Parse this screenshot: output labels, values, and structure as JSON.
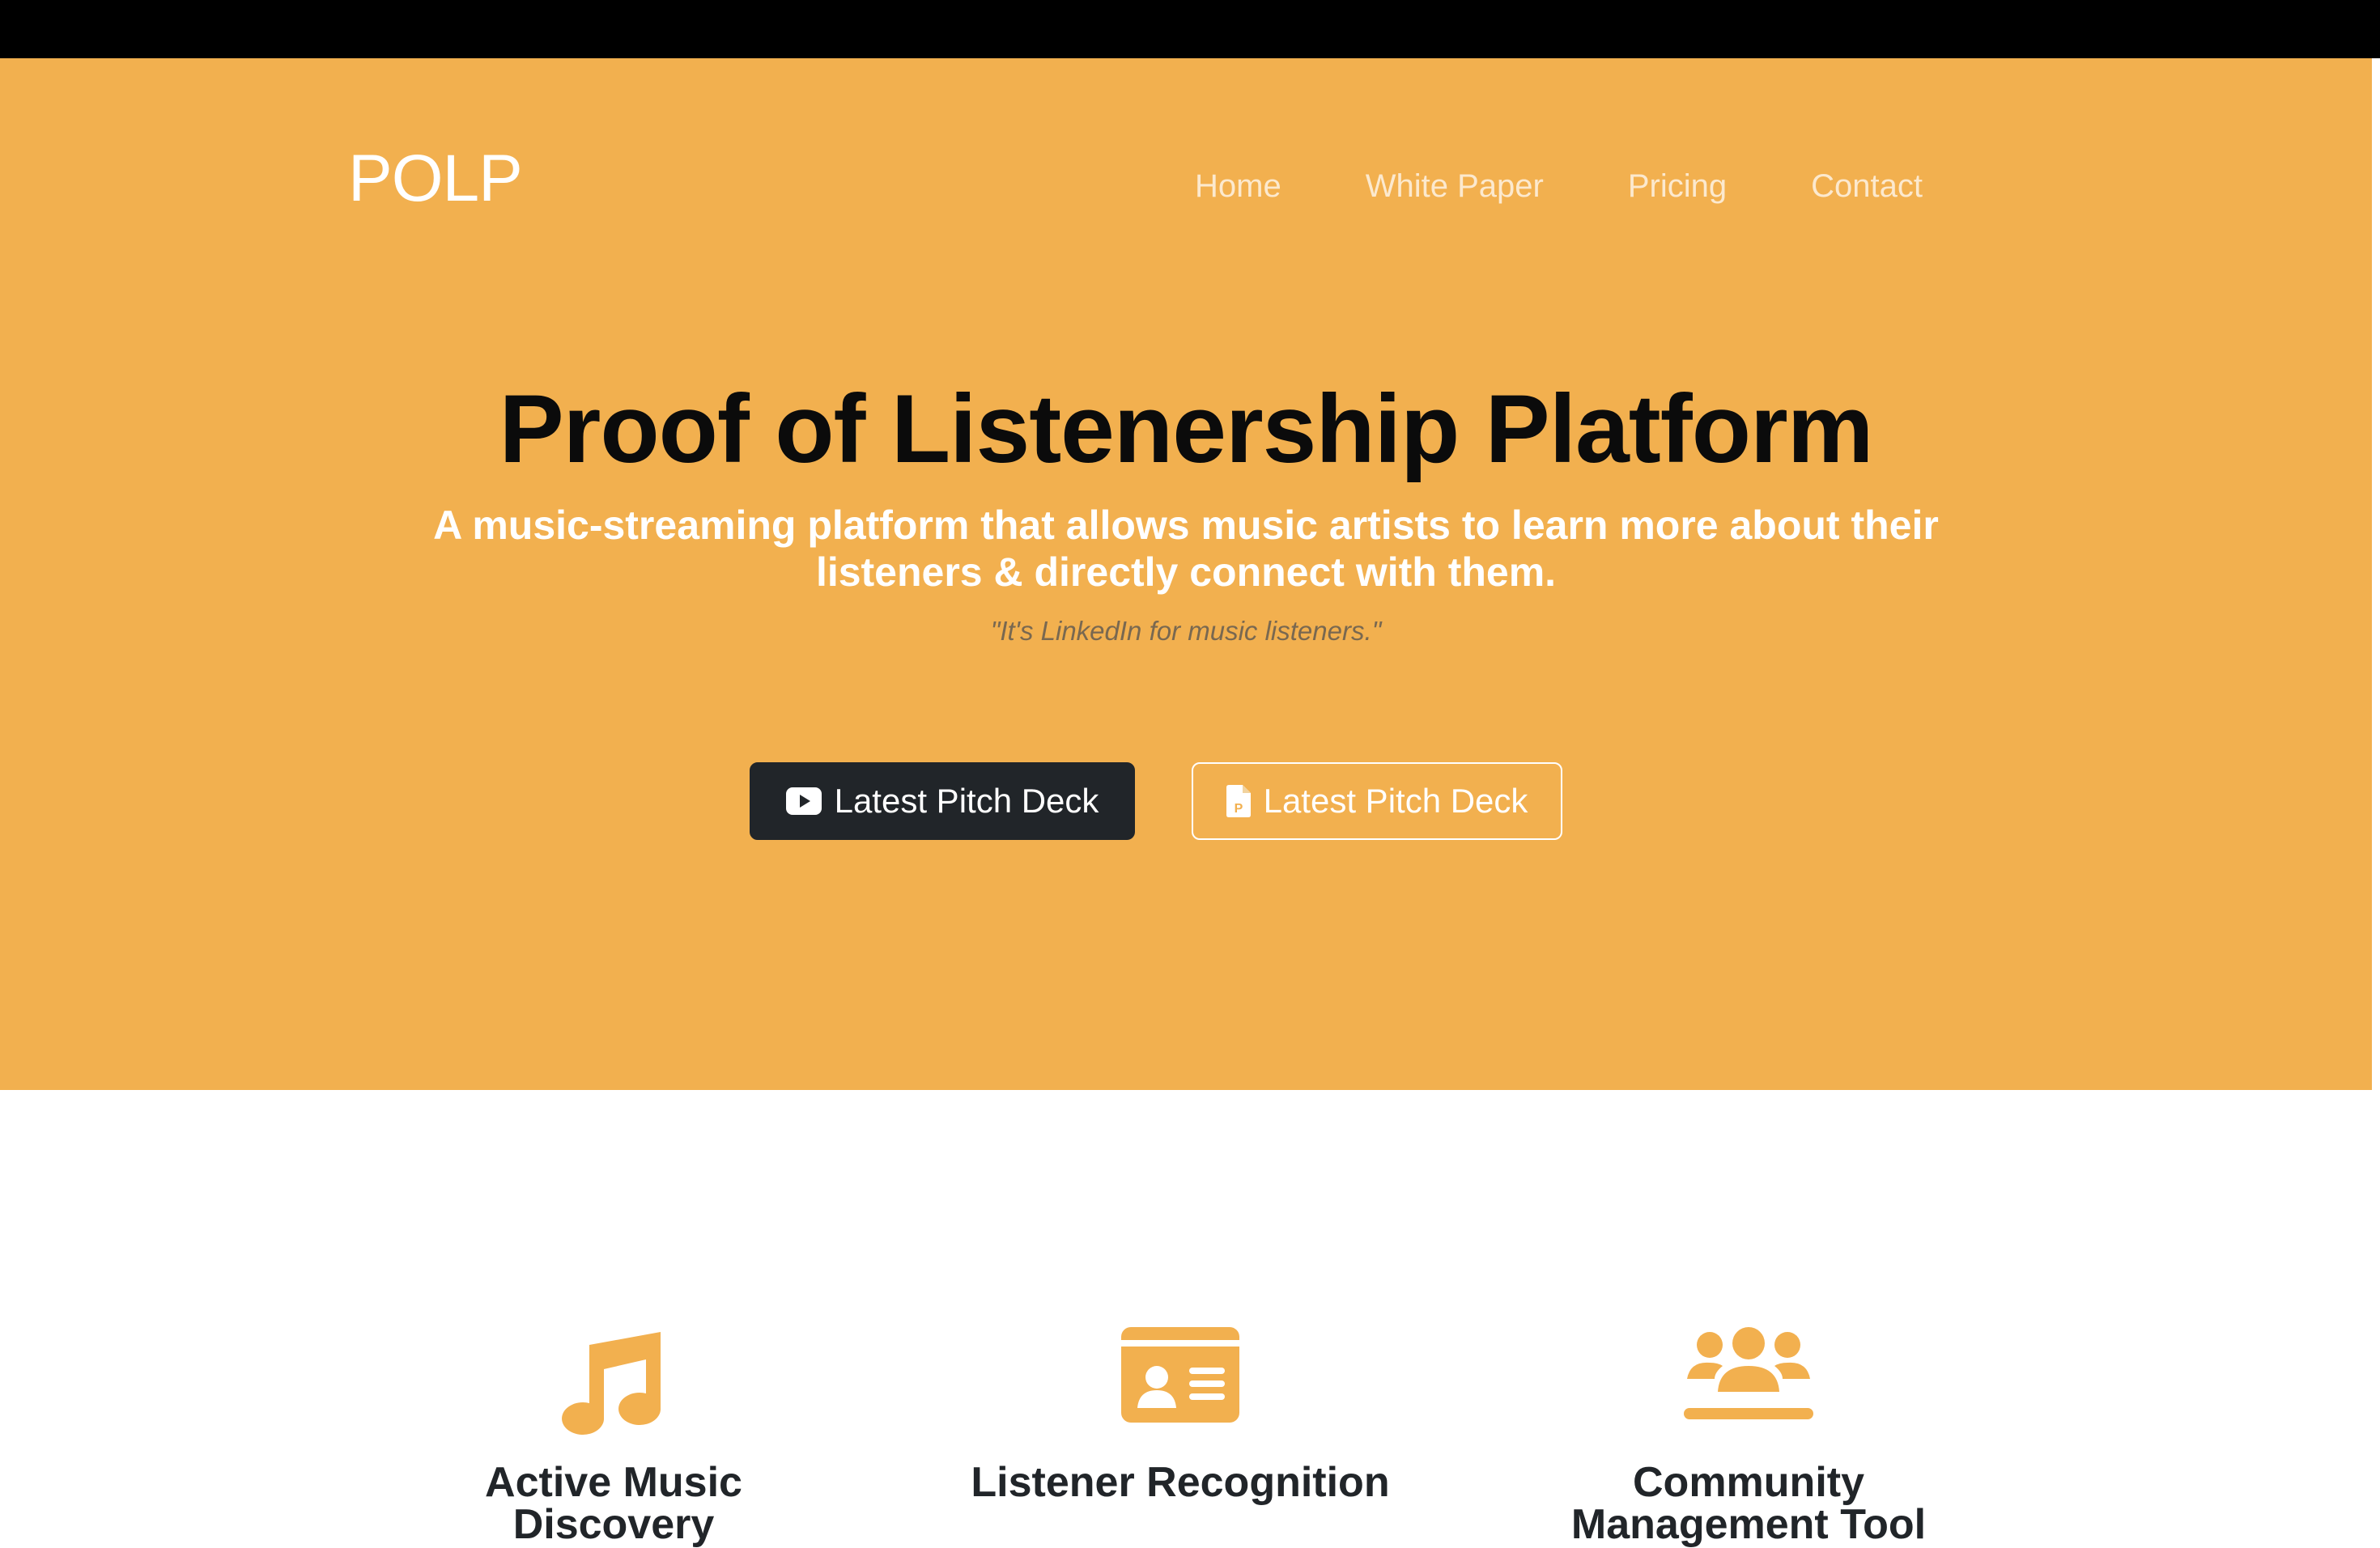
{
  "nav": {
    "brand": "POLP",
    "links": [
      "Home",
      "White Paper",
      "Pricing",
      "Contact"
    ]
  },
  "hero": {
    "title": "Proof of Listenership Platform",
    "subtitle": "A music-streaming platform that allows music artists to learn more about their listeners & directly connect with them.",
    "quote": "\"It's LinkedIn for music listeners.\"",
    "buttons": [
      {
        "label": "Latest Pitch Deck",
        "icon": "youtube-icon"
      },
      {
        "label": "Latest Pitch Deck",
        "icon": "file-pdf-icon"
      }
    ]
  },
  "features": [
    {
      "title": "Active Music Discovery",
      "icon": "music-note-icon"
    },
    {
      "title": "Listener Recognition",
      "icon": "id-card-icon"
    },
    {
      "title": "Community Management Tool",
      "icon": "users-icon"
    }
  ],
  "colors": {
    "accent": "#f2b04f",
    "dark": "#212529",
    "topbar": "#000000"
  }
}
